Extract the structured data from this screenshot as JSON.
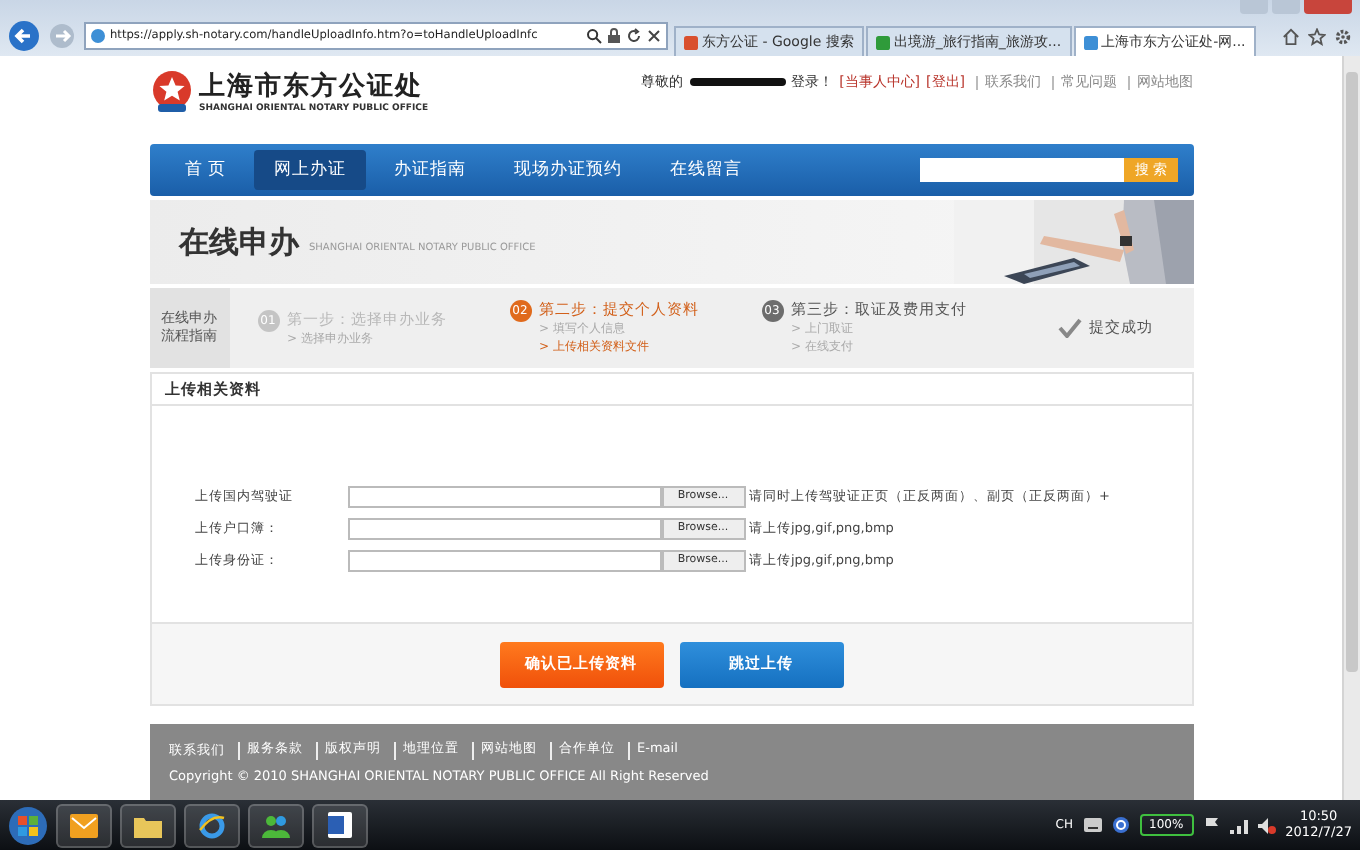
{
  "browser": {
    "address": "https://apply.sh-notary.com/handleUploadInfo.htm?o=toHandleUploadInfc",
    "tabs": [
      {
        "title": "东方公证 - Google 搜索",
        "selected": false
      },
      {
        "title": "出境游_旅行指南_旅游攻...",
        "selected": false
      },
      {
        "title": "上海市东方公证处-网...",
        "selected": true
      }
    ]
  },
  "header": {
    "logo_title": "上海市东方公证处",
    "logo_subtitle": "SHANGHAI ORIENTAL NOTARY PUBLIC OFFICE",
    "greeting": "尊敬的",
    "greeting_end": "登录！",
    "user_links": [
      "[当事人中心]",
      "[登出]"
    ],
    "top_links": [
      "联系我们",
      "常见问题",
      "网站地图"
    ]
  },
  "nav": {
    "items": [
      {
        "label": "首 页",
        "selected": false
      },
      {
        "label": "网上办证",
        "selected": true
      },
      {
        "label": "办证指南",
        "selected": false
      },
      {
        "label": "现场办证预约",
        "selected": false
      },
      {
        "label": "在线留言",
        "selected": false
      }
    ],
    "search_button": "搜 索"
  },
  "banner": {
    "title": "在线申办",
    "subtitle": "SHANGHAI ORIENTAL NOTARY PUBLIC OFFICE"
  },
  "steps": {
    "guide": [
      "在线申办",
      "流程指南"
    ],
    "items": [
      {
        "number": "01",
        "title": "第一步：选择申办业务",
        "kind": "done",
        "subitems": [
          {
            "text": "> 选择申办业务",
            "selected": false
          }
        ]
      },
      {
        "number": "02",
        "title": "第二步：提交个人资料",
        "kind": "current",
        "subitems": [
          {
            "text": "> 填写个人信息",
            "selected": false
          },
          {
            "text": "> 上传相关资料文件",
            "selected": true
          }
        ]
      },
      {
        "number": "03",
        "title": "第三步：取证及费用支付",
        "kind": "pending",
        "subitems": [
          {
            "text": "> 上门取证",
            "selected": false
          },
          {
            "text": "> 在线支付",
            "selected": false
          }
        ]
      }
    ],
    "final": "提交成功"
  },
  "section_title": "上传相关资料",
  "uploads": [
    {
      "label": "上传国内驾驶证",
      "button": "Browse...",
      "hint": "请同时上传驾驶证正页（正反两面）、副页（正反两面）+"
    },
    {
      "label": "上传户口簿：",
      "button": "Browse...",
      "hint": "请上传jpg,gif,png,bmp"
    },
    {
      "label": "上传身份证：",
      "button": "Browse...",
      "hint": "请上传jpg,gif,png,bmp"
    }
  ],
  "buttons": [
    {
      "label": "确认已上传资料",
      "kind": "primary"
    },
    {
      "label": "跳过上传",
      "kind": "secondary"
    }
  ],
  "footer": {
    "links": [
      "联系我们",
      "服务条款",
      "版权声明",
      "地理位置",
      "网站地图",
      "合作单位",
      "E-mail"
    ],
    "copyright": "Copyright © 2010 SHANGHAI ORIENTAL NOTARY PUBLIC OFFICE All Right Reserved"
  },
  "taskbar": {
    "language": "CH",
    "battery": "100%",
    "time": "10:50",
    "date": "2012/7/27"
  }
}
